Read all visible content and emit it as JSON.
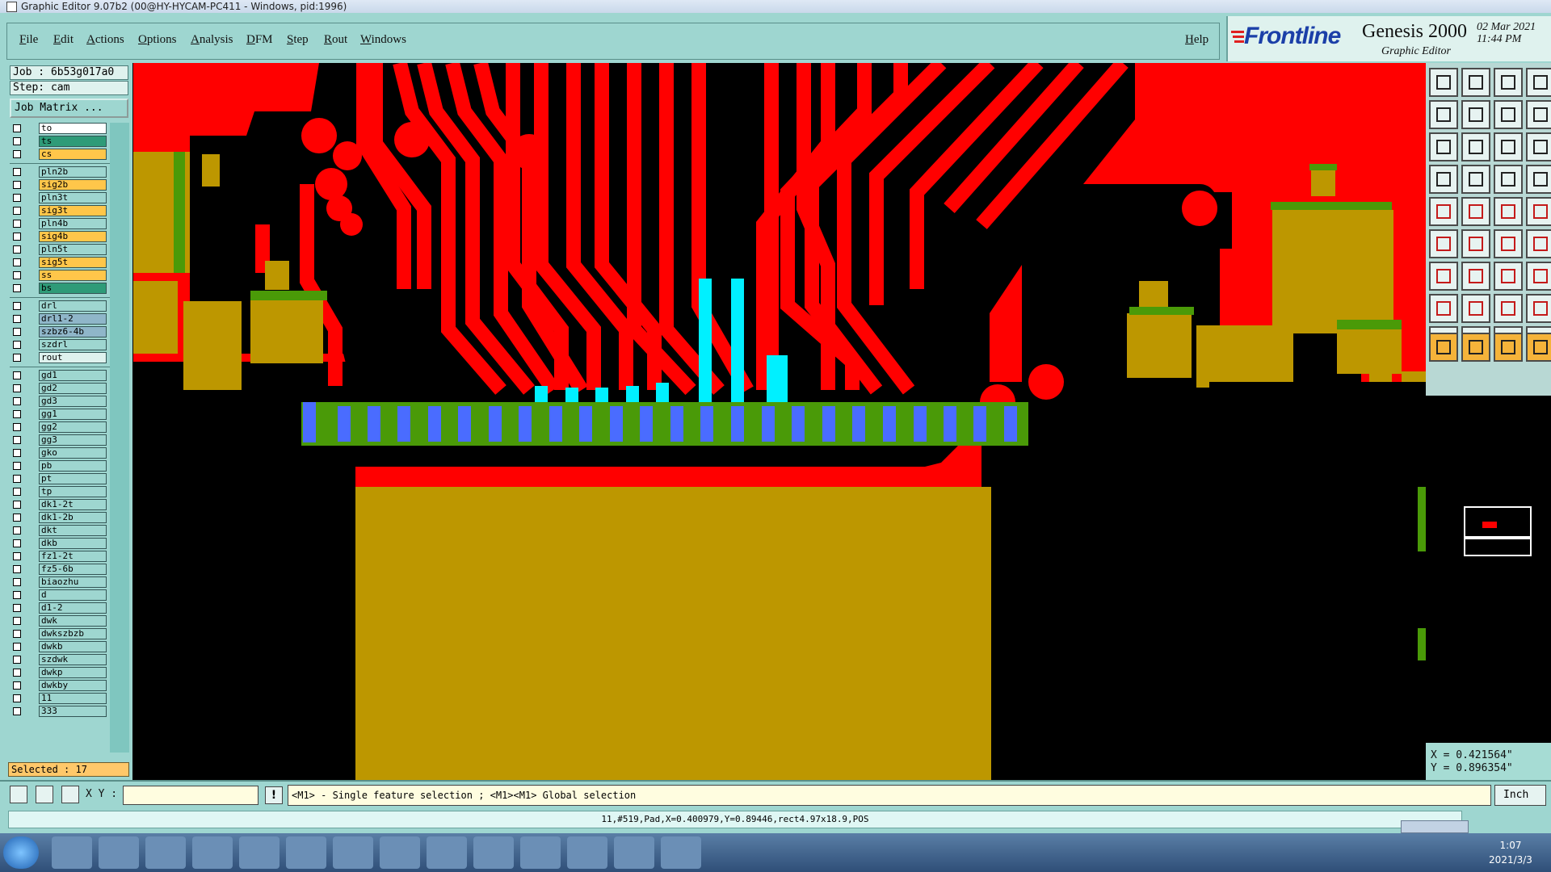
{
  "window": {
    "title": "Graphic Editor 9.07b2 (00@HY-HYCAM-PC411 - Windows, pid:1996)"
  },
  "menu": {
    "items": [
      "File",
      "Edit",
      "Actions",
      "Options",
      "Analysis",
      "DFM",
      "Step",
      "Rout",
      "Windows"
    ],
    "help": "Help"
  },
  "branding": {
    "logo": "Frontline",
    "product": "Genesis 2000",
    "subtitle": "Graphic Editor",
    "date": "02 Mar 2021",
    "time": "11:44 PM"
  },
  "job": {
    "job_label": "Job : 6b53g017a0",
    "step_label": "Step: cam",
    "matrix_button": "Job Matrix ..."
  },
  "layers": {
    "group1": [
      {
        "name": "to",
        "color": "#ffffff"
      },
      {
        "name": "ts",
        "color": "#2e9b78"
      },
      {
        "name": "cs",
        "color": "#ffc64a"
      }
    ],
    "group2": [
      {
        "name": "pln2b",
        "color": "#9ed6d0"
      },
      {
        "name": "sig2b",
        "color": "#ffc64a"
      },
      {
        "name": "pln3t",
        "color": "#9ed6d0"
      },
      {
        "name": "sig3t",
        "color": "#ffc64a"
      },
      {
        "name": "pln4b",
        "color": "#9ed6d0"
      },
      {
        "name": "sig4b",
        "color": "#ffc64a"
      },
      {
        "name": "pln5t",
        "color": "#9ed6d0"
      },
      {
        "name": "sig5t",
        "color": "#ffc64a"
      },
      {
        "name": "ss",
        "color": "#ffc64a"
      },
      {
        "name": "bs",
        "color": "#2e9b78"
      }
    ],
    "group3": [
      {
        "name": "drl",
        "color": "#9ed6d0"
      },
      {
        "name": "drl1-2",
        "color": "#8fb6c9"
      },
      {
        "name": "szbz6-4b",
        "color": "#8fb6c9"
      },
      {
        "name": "szdrl",
        "color": "#9ed6d0"
      },
      {
        "name": "rout",
        "color": "#dff2ee"
      }
    ],
    "group4": [
      {
        "name": "gd1",
        "color": "#9ed6d0"
      },
      {
        "name": "gd2",
        "color": "#9ed6d0"
      },
      {
        "name": "gd3",
        "color": "#9ed6d0"
      },
      {
        "name": "gg1",
        "color": "#9ed6d0"
      },
      {
        "name": "gg2",
        "color": "#9ed6d0"
      },
      {
        "name": "gg3",
        "color": "#9ed6d0"
      },
      {
        "name": "gko",
        "color": "#9ed6d0"
      },
      {
        "name": "pb",
        "color": "#9ed6d0"
      },
      {
        "name": "pt",
        "color": "#9ed6d0"
      },
      {
        "name": "tp",
        "color": "#9ed6d0"
      },
      {
        "name": "dk1-2t",
        "color": "#9ed6d0"
      },
      {
        "name": "dk1-2b",
        "color": "#9ed6d0"
      },
      {
        "name": "dkt",
        "color": "#9ed6d0"
      },
      {
        "name": "dkb",
        "color": "#9ed6d0"
      },
      {
        "name": "fz1-2t",
        "color": "#9ed6d0"
      },
      {
        "name": "fz5-6b",
        "color": "#9ed6d0"
      },
      {
        "name": "biaozhu",
        "color": "#9ed6d0"
      },
      {
        "name": "d",
        "color": "#9ed6d0"
      },
      {
        "name": "d1-2",
        "color": "#9ed6d0"
      },
      {
        "name": "dwk",
        "color": "#9ed6d0"
      },
      {
        "name": "dwkszbzb",
        "color": "#9ed6d0"
      },
      {
        "name": "dwkb",
        "color": "#9ed6d0"
      },
      {
        "name": "szdwk",
        "color": "#9ed6d0"
      },
      {
        "name": "dwkp",
        "color": "#9ed6d0"
      },
      {
        "name": "dwkby",
        "color": "#9ed6d0"
      },
      {
        "name": "11",
        "color": "#9ed6d0"
      },
      {
        "name": "333",
        "color": "#9ed6d0"
      }
    ]
  },
  "selection": {
    "label": "Selected : 17"
  },
  "coords": {
    "x": "X = 0.421564\"",
    "y": "Y = 0.896354\""
  },
  "command": {
    "xy_label": "X Y :",
    "xy_value": "",
    "exclaim": "!",
    "prompt": "<M1> - Single feature selection ; <M1><M1> Global selection",
    "unit": "Inch"
  },
  "status": {
    "line": "11,#519,Pad,X=0.400979,Y=0.89446,rect4.97x18.9,POS"
  },
  "taskbar": {
    "time": "1:07",
    "date": "2021/3/3"
  },
  "colors": {
    "background": "#000000",
    "copper": "#ff0000",
    "gold_area": "#bd9700",
    "mask_green": "#4a9a08",
    "pad_blue": "#4a6cff",
    "pad_cyan": "#00f0ff",
    "panel": "#9ed6d0"
  }
}
